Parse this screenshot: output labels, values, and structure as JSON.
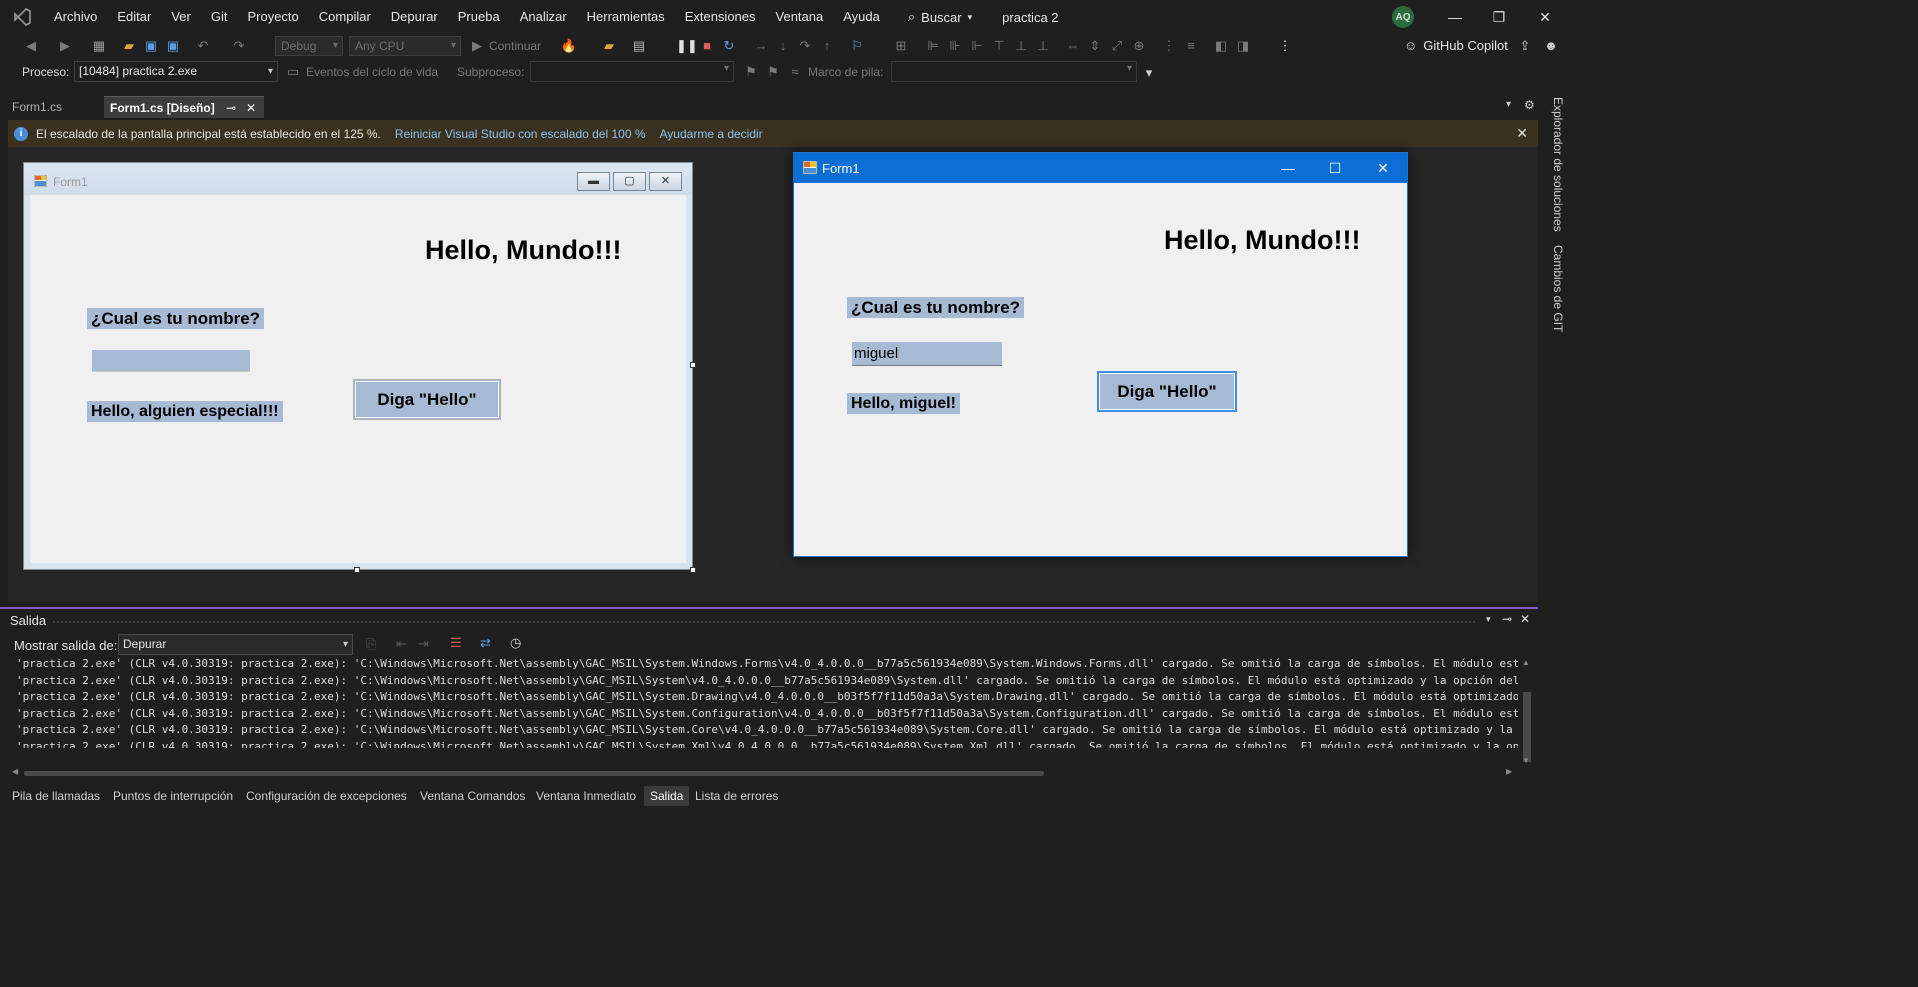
{
  "menubar": {
    "items": [
      "Archivo",
      "Editar",
      "Ver",
      "Git",
      "Proyecto",
      "Compilar",
      "Depurar",
      "Prueba",
      "Analizar",
      "Herramientas",
      "Extensiones",
      "Ventana",
      "Ayuda"
    ],
    "search_label": "Buscar",
    "project_name": "practica 2",
    "avatar_initials": "AQ"
  },
  "toolbar": {
    "config": "Debug",
    "platform": "Any CPU",
    "continue_label": "Continuar",
    "copilot_label": "GitHub Copilot"
  },
  "toolbar2": {
    "process_label": "Proceso:",
    "process_value": "[10484] practica 2.exe",
    "lifecycle_label": "Eventos del ciclo de vida",
    "thread_label": "Subproceso:",
    "stack_label": "Marco de pila:"
  },
  "tabs": [
    {
      "label": "Form1.cs"
    },
    {
      "label": "Form1.cs [Diseño]"
    }
  ],
  "infobar": {
    "message": "El escalado de la pantalla principal está establecido en el 125 %.",
    "link1": "Reiniciar Visual Studio con escalado del 100 %",
    "link2": "Ayudarme a decidir"
  },
  "designer_form": {
    "title": "Form1",
    "hello_label": "Hello, Mundo!!!",
    "question_label": "¿Cual es tu nombre?",
    "textbox_value": "",
    "greeting_label": "Hello, alguien especial!!!",
    "button_label": "Diga \"Hello\""
  },
  "runtime_form": {
    "title": "Form1",
    "hello_label": "Hello, Mundo!!!",
    "question_label": "¿Cual es tu nombre?",
    "textbox_value": "miguel",
    "greeting_label": "Hello, miguel!",
    "button_label": "Diga \"Hello\""
  },
  "output": {
    "title": "Salida",
    "show_label": "Mostrar salida de:",
    "source": "Depurar",
    "lines": [
      "'practica 2.exe' (CLR v4.0.30319: practica 2.exe): 'C:\\Windows\\Microsoft.Net\\assembly\\GAC_MSIL\\System.Windows.Forms\\v4.0_4.0.0.0__b77a5c561934e089\\System.Windows.Forms.dll' cargado. Se omitió la carga de símbolos. El módulo está",
      "'practica 2.exe' (CLR v4.0.30319: practica 2.exe): 'C:\\Windows\\Microsoft.Net\\assembly\\GAC_MSIL\\System\\v4.0_4.0.0.0__b77a5c561934e089\\System.dll' cargado. Se omitió la carga de símbolos. El módulo está optimizado y la opción del d",
      "'practica 2.exe' (CLR v4.0.30319: practica 2.exe): 'C:\\Windows\\Microsoft.Net\\assembly\\GAC_MSIL\\System.Drawing\\v4.0_4.0.0.0__b03f5f7f11d50a3a\\System.Drawing.dll' cargado. Se omitió la carga de símbolos. El módulo está optimizado y",
      "'practica 2.exe' (CLR v4.0.30319: practica 2.exe): 'C:\\Windows\\Microsoft.Net\\assembly\\GAC_MSIL\\System.Configuration\\v4.0_4.0.0.0__b03f5f7f11d50a3a\\System.Configuration.dll' cargado. Se omitió la carga de símbolos. El módulo está",
      "'practica 2.exe' (CLR v4.0.30319: practica 2.exe): 'C:\\Windows\\Microsoft.Net\\assembly\\GAC_MSIL\\System.Core\\v4.0_4.0.0.0__b77a5c561934e089\\System.Core.dll' cargado. Se omitió la carga de símbolos. El módulo está optimizado y la op",
      "'practica 2.exe' (CLR v4.0.30319: practica 2.exe): 'C:\\Windows\\Microsoft.Net\\assembly\\GAC_MSIL\\System.Xml\\v4.0_4.0.0.0__b77a5c561934e089\\System.Xml.dll' cargado. Se omitió la carga de símbolos. El módulo está optimizado y la opci"
    ]
  },
  "bottom_tabs": [
    "Pila de llamadas",
    "Puntos de interrupción",
    "Configuración de excepciones",
    "Ventana Comandos",
    "Ventana Inmediato",
    "Salida",
    "Lista de errores"
  ],
  "side_tabs": [
    "Explorador de soluciones",
    "Cambios de GIT"
  ],
  "colors": {
    "accent_purple": "#7b5fc4",
    "runtime_titlebar": "#0b6fd6",
    "label_highlight": "#a7bad3",
    "infobar_bg": "#3a3120",
    "link": "#8cc2f0"
  }
}
